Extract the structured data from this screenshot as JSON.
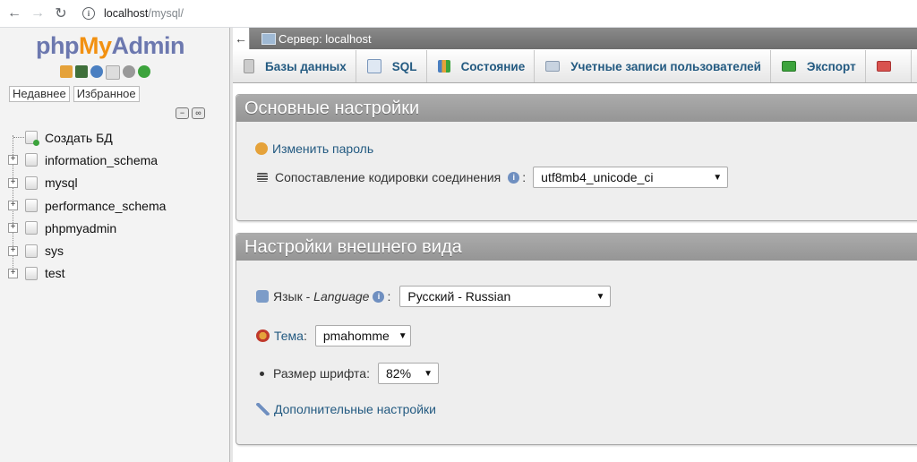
{
  "browser": {
    "url_host": "localhost",
    "url_path": "/mysql/"
  },
  "logo": {
    "php": "php",
    "my": "My",
    "admin": "Admin"
  },
  "left_tabs": {
    "recent": "Недавнее",
    "favorites": "Избранное"
  },
  "tree": {
    "new_db": "Создать БД",
    "databases": [
      "information_schema",
      "mysql",
      "performance_schema",
      "phpmyadmin",
      "sys",
      "test"
    ]
  },
  "server_bar": {
    "label": "Сервер: localhost"
  },
  "menu": {
    "items": [
      {
        "label": "Базы данных",
        "icon": "databases-icon"
      },
      {
        "label": "SQL",
        "icon": "sql-icon"
      },
      {
        "label": "Состояние",
        "icon": "status-icon"
      },
      {
        "label": "Учетные записи пользователей",
        "icon": "users-icon"
      },
      {
        "label": "Экспорт",
        "icon": "export-icon"
      }
    ]
  },
  "general": {
    "title": "Основные настройки",
    "change_password": "Изменить пароль",
    "collation_label": "Сопоставление кодировки соединения",
    "collation_value": "utf8mb4_unicode_ci"
  },
  "appearance": {
    "title": "Настройки внешнего вида",
    "language_label": "Язык - ",
    "language_label_en": "Language",
    "language_value": "Русский - Russian",
    "theme_label": "Тема",
    "theme_value": "pmahomme",
    "font_size_label": "Размер шрифта:",
    "font_size_value": "82%",
    "more_settings": "Дополнительные настройки"
  },
  "colors": {
    "link": "#235a81",
    "logo_blue": "#6c78af",
    "logo_orange": "#f29111"
  }
}
